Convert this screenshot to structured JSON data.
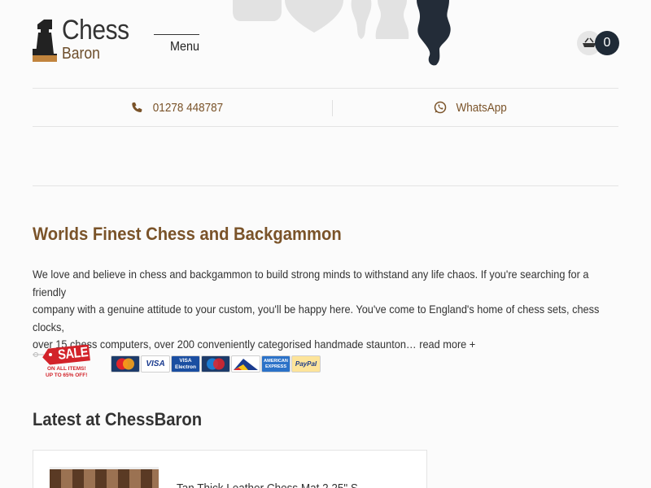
{
  "header": {
    "logo_chess": "Chess",
    "logo_baron": "Baron",
    "menu_label": "Menu",
    "cart_count": "0"
  },
  "contact": {
    "phone": "01278 448787",
    "whatsapp": "WhatsApp"
  },
  "main": {
    "title": "Worlds Finest Chess and Backgammon",
    "intro_line1": "We love and believe in chess and backgammon to build strong minds to withstand any life chaos. If you're searching for a friendly",
    "intro_line2": "company with a genuine attitude to your custom, you'll be happy here. You've come to England's home of chess sets, chess clocks,",
    "intro_line3": "over 15 chess computers, over 200 conveniently categorised handmade staunton…",
    "read_more": "read more +",
    "sale_text": "SALE",
    "sale_sub1": "ON ALL ITEMS!",
    "sale_sub2": "UP TO 65% OFF!",
    "payment_cards": [
      "MasterCard",
      "VISA",
      "VISA Electron",
      "Maestro",
      "DELTA",
      "AMERICAN EXPRESS",
      "PayPal"
    ],
    "latest_heading": "Latest at ChessBaron",
    "news_title": "Tan Thick Leather Chess Mat 2.25\" S..."
  },
  "colors": {
    "brand_brown": "#7a5329",
    "dark_navy": "#1f2a36",
    "sale_red": "#d2232a"
  }
}
